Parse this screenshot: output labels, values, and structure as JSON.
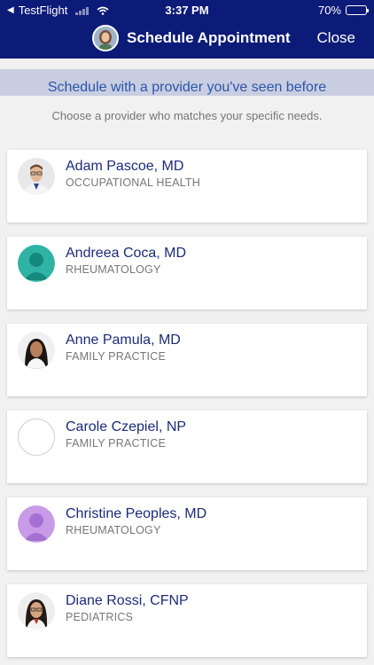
{
  "status_bar": {
    "back_app": "TestFlight",
    "time": "3:37 PM",
    "battery_percent_text": "70%",
    "battery_level": 0.7
  },
  "nav": {
    "title": "Schedule Appointment",
    "close_label": "Close",
    "background_color": "#0c1a78"
  },
  "banner": {
    "text": "Schedule with a provider you've seen before"
  },
  "subtitle": "Choose a provider who matches your specific needs.",
  "providers": [
    {
      "name": "Adam Pascoe, MD",
      "specialty": "OCCUPATIONAL HEALTH",
      "avatar": "photo-man-glasses"
    },
    {
      "name": "Andreea Coca, MD",
      "specialty": "RHEUMATOLOGY",
      "avatar": "placeholder-teal"
    },
    {
      "name": "Anne Pamula, MD",
      "specialty": "FAMILY PRACTICE",
      "avatar": "photo-woman-dark-hair"
    },
    {
      "name": "Carole Czepiel, NP",
      "specialty": "FAMILY PRACTICE",
      "avatar": "empty-circle"
    },
    {
      "name": "Christine Peoples, MD",
      "specialty": "RHEUMATOLOGY",
      "avatar": "placeholder-purple"
    },
    {
      "name": "Diane Rossi, CFNP",
      "specialty": "PEDIATRICS",
      "avatar": "photo-woman-glasses"
    }
  ]
}
